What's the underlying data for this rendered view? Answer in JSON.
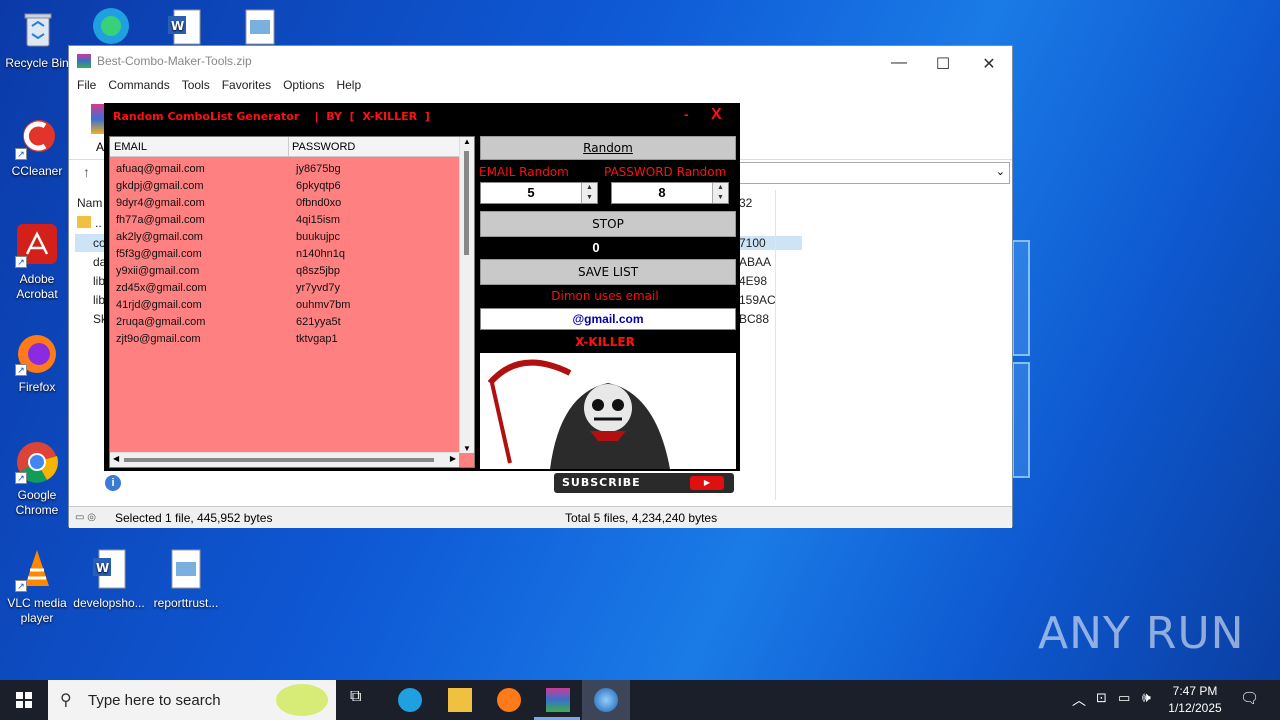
{
  "desktop": {
    "icons": [
      {
        "label": "Recycle Bin"
      },
      {
        "label": "CCleaner"
      },
      {
        "label": "Adobe Acrobat"
      },
      {
        "label": "Firefox"
      },
      {
        "label": "Google Chrome"
      },
      {
        "label": "VLC media player"
      },
      {
        "label": "developsho..."
      },
      {
        "label": "reporttrust..."
      }
    ],
    "watermark": "ANY RUN"
  },
  "winrar": {
    "title": "Best-Combo-Maker-Tools.zip",
    "menu": [
      "File",
      "Commands",
      "Tools",
      "Favorites",
      "Options",
      "Help"
    ],
    "status_left": "Selected 1 file, 445,952 bytes",
    "status_right": "Total 5 files, 4,234,240 bytes",
    "visible_fragments": {
      "toolbar_a": "A",
      "col_name": "Nam",
      "up": "..",
      "rows": [
        "co",
        "da",
        "lib",
        "lib",
        "Sk"
      ],
      "right_vals": [
        "32",
        "7100",
        "ABAA",
        "4E98",
        "159AC",
        "BC88"
      ]
    }
  },
  "app": {
    "title": "Random ComboList Generator    |  BY  [  X-KILLER  ]",
    "minimize": "-",
    "close": "X",
    "columns": {
      "email": "EMAIL",
      "password": "PASSWORD"
    },
    "rows": [
      {
        "email": "afuaq@gmail.com",
        "password": "jy8675bg"
      },
      {
        "email": "gkdpj@gmail.com",
        "password": "6pkyqtp6"
      },
      {
        "email": "9dyr4@gmail.com",
        "password": "0fbnd0xo"
      },
      {
        "email": "fh77a@gmail.com",
        "password": "4qi15ism"
      },
      {
        "email": "ak2ly@gmail.com",
        "password": "buukujpc"
      },
      {
        "email": "f5f3g@gmail.com",
        "password": "n140hn1q"
      },
      {
        "email": "y9xii@gmail.com",
        "password": "q8sz5jbp"
      },
      {
        "email": "zd45x@gmail.com",
        "password": "yr7yvd7y"
      },
      {
        "email": "41rjd@gmail.com",
        "password": "ouhmv7bm"
      },
      {
        "email": "2ruqa@gmail.com",
        "password": "621yya5t"
      },
      {
        "email": "zjt9o@gmail.com",
        "password": "tktvgap1"
      }
    ],
    "random_button": "Random",
    "email_random_label": "EMAIL Random",
    "password_random_label": "PASSWORD Random",
    "email_random_value": "5",
    "password_random_value": "8",
    "stop_button": "STOP",
    "counter": "0",
    "save_button": "SAVE LIST",
    "domain_label": "Dimon uses email",
    "domain_value": "@gmail.com",
    "author": "X-KILLER",
    "subscribe": "SUBSCRIBE"
  },
  "taskbar": {
    "search_placeholder": "Type here to search",
    "time": "7:47 PM",
    "date": "1/12/2025"
  }
}
